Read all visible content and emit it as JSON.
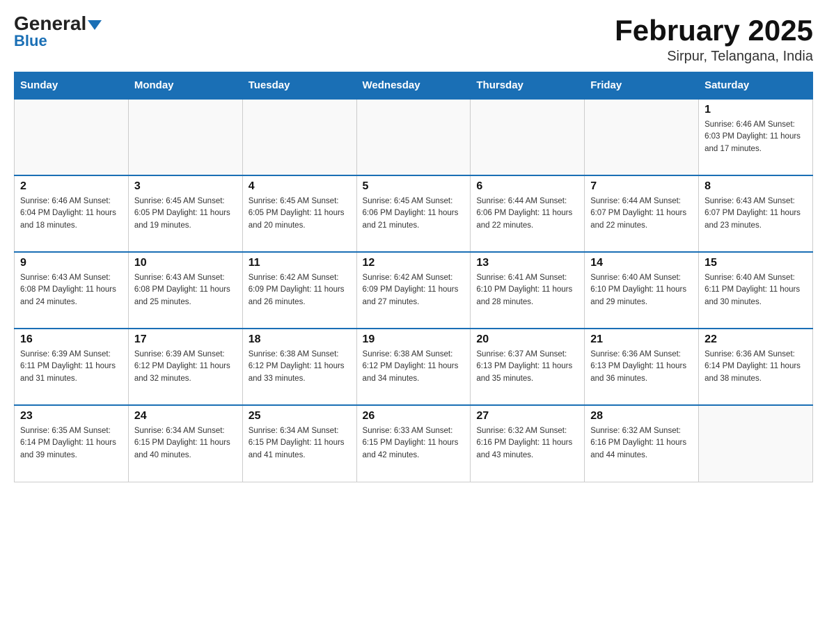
{
  "header": {
    "logo_main": "General",
    "logo_sub": "Blue",
    "month_title": "February 2025",
    "location": "Sirpur, Telangana, India"
  },
  "weekdays": [
    "Sunday",
    "Monday",
    "Tuesday",
    "Wednesday",
    "Thursday",
    "Friday",
    "Saturday"
  ],
  "weeks": [
    [
      {
        "day": "",
        "info": ""
      },
      {
        "day": "",
        "info": ""
      },
      {
        "day": "",
        "info": ""
      },
      {
        "day": "",
        "info": ""
      },
      {
        "day": "",
        "info": ""
      },
      {
        "day": "",
        "info": ""
      },
      {
        "day": "1",
        "info": "Sunrise: 6:46 AM\nSunset: 6:03 PM\nDaylight: 11 hours and 17 minutes."
      }
    ],
    [
      {
        "day": "2",
        "info": "Sunrise: 6:46 AM\nSunset: 6:04 PM\nDaylight: 11 hours and 18 minutes."
      },
      {
        "day": "3",
        "info": "Sunrise: 6:45 AM\nSunset: 6:05 PM\nDaylight: 11 hours and 19 minutes."
      },
      {
        "day": "4",
        "info": "Sunrise: 6:45 AM\nSunset: 6:05 PM\nDaylight: 11 hours and 20 minutes."
      },
      {
        "day": "5",
        "info": "Sunrise: 6:45 AM\nSunset: 6:06 PM\nDaylight: 11 hours and 21 minutes."
      },
      {
        "day": "6",
        "info": "Sunrise: 6:44 AM\nSunset: 6:06 PM\nDaylight: 11 hours and 22 minutes."
      },
      {
        "day": "7",
        "info": "Sunrise: 6:44 AM\nSunset: 6:07 PM\nDaylight: 11 hours and 22 minutes."
      },
      {
        "day": "8",
        "info": "Sunrise: 6:43 AM\nSunset: 6:07 PM\nDaylight: 11 hours and 23 minutes."
      }
    ],
    [
      {
        "day": "9",
        "info": "Sunrise: 6:43 AM\nSunset: 6:08 PM\nDaylight: 11 hours and 24 minutes."
      },
      {
        "day": "10",
        "info": "Sunrise: 6:43 AM\nSunset: 6:08 PM\nDaylight: 11 hours and 25 minutes."
      },
      {
        "day": "11",
        "info": "Sunrise: 6:42 AM\nSunset: 6:09 PM\nDaylight: 11 hours and 26 minutes."
      },
      {
        "day": "12",
        "info": "Sunrise: 6:42 AM\nSunset: 6:09 PM\nDaylight: 11 hours and 27 minutes."
      },
      {
        "day": "13",
        "info": "Sunrise: 6:41 AM\nSunset: 6:10 PM\nDaylight: 11 hours and 28 minutes."
      },
      {
        "day": "14",
        "info": "Sunrise: 6:40 AM\nSunset: 6:10 PM\nDaylight: 11 hours and 29 minutes."
      },
      {
        "day": "15",
        "info": "Sunrise: 6:40 AM\nSunset: 6:11 PM\nDaylight: 11 hours and 30 minutes."
      }
    ],
    [
      {
        "day": "16",
        "info": "Sunrise: 6:39 AM\nSunset: 6:11 PM\nDaylight: 11 hours and 31 minutes."
      },
      {
        "day": "17",
        "info": "Sunrise: 6:39 AM\nSunset: 6:12 PM\nDaylight: 11 hours and 32 minutes."
      },
      {
        "day": "18",
        "info": "Sunrise: 6:38 AM\nSunset: 6:12 PM\nDaylight: 11 hours and 33 minutes."
      },
      {
        "day": "19",
        "info": "Sunrise: 6:38 AM\nSunset: 6:12 PM\nDaylight: 11 hours and 34 minutes."
      },
      {
        "day": "20",
        "info": "Sunrise: 6:37 AM\nSunset: 6:13 PM\nDaylight: 11 hours and 35 minutes."
      },
      {
        "day": "21",
        "info": "Sunrise: 6:36 AM\nSunset: 6:13 PM\nDaylight: 11 hours and 36 minutes."
      },
      {
        "day": "22",
        "info": "Sunrise: 6:36 AM\nSunset: 6:14 PM\nDaylight: 11 hours and 38 minutes."
      }
    ],
    [
      {
        "day": "23",
        "info": "Sunrise: 6:35 AM\nSunset: 6:14 PM\nDaylight: 11 hours and 39 minutes."
      },
      {
        "day": "24",
        "info": "Sunrise: 6:34 AM\nSunset: 6:15 PM\nDaylight: 11 hours and 40 minutes."
      },
      {
        "day": "25",
        "info": "Sunrise: 6:34 AM\nSunset: 6:15 PM\nDaylight: 11 hours and 41 minutes."
      },
      {
        "day": "26",
        "info": "Sunrise: 6:33 AM\nSunset: 6:15 PM\nDaylight: 11 hours and 42 minutes."
      },
      {
        "day": "27",
        "info": "Sunrise: 6:32 AM\nSunset: 6:16 PM\nDaylight: 11 hours and 43 minutes."
      },
      {
        "day": "28",
        "info": "Sunrise: 6:32 AM\nSunset: 6:16 PM\nDaylight: 11 hours and 44 minutes."
      },
      {
        "day": "",
        "info": ""
      }
    ]
  ]
}
